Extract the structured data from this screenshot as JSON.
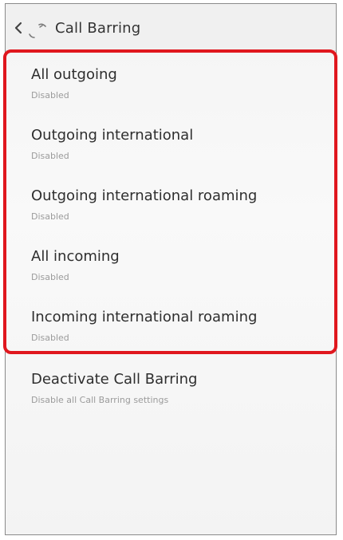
{
  "header": {
    "title": "Call Barring",
    "back_icon": "chevron-left-icon",
    "app_icon": "phone-settings-icon"
  },
  "highlight": {
    "color": "#e0171e"
  },
  "items": [
    {
      "title": "All outgoing",
      "summary": "Disabled"
    },
    {
      "title": "Outgoing international",
      "summary": "Disabled"
    },
    {
      "title": "Outgoing international roaming",
      "summary": "Disabled"
    },
    {
      "title": "All incoming",
      "summary": "Disabled"
    },
    {
      "title": "Incoming international roaming",
      "summary": "Disabled"
    }
  ],
  "deactivate": {
    "title": "Deactivate Call Barring",
    "summary": "Disable all Call Barring settings"
  }
}
